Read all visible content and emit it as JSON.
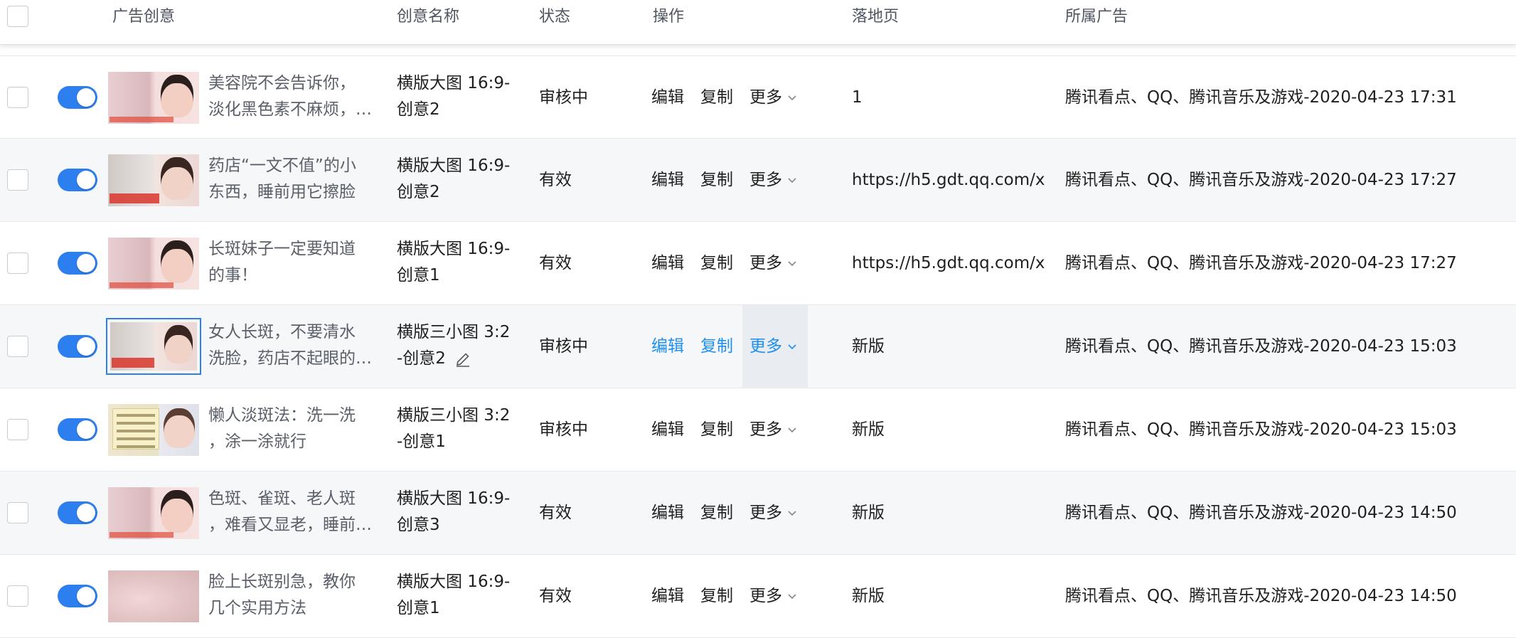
{
  "header": {
    "columns": {
      "creative": "广告创意",
      "name": "创意名称",
      "status": "状态",
      "ops": "操作",
      "landing": "落地页",
      "ad": "所属广告"
    }
  },
  "actions": {
    "edit": "编辑",
    "copy": "复制",
    "more": "更多"
  },
  "colors": {
    "accent": "#2d7ff0",
    "link": "#1c8ff0"
  },
  "rows": [
    {
      "title1": "美容院不会告诉你，",
      "title2": "淡化黑色素不麻烦，…",
      "name1": "横版大图 16:9-",
      "name2": "创意2",
      "status": "审核中",
      "landing": "1",
      "ad": "腾讯看点、QQ、腾讯音乐及游戏-2020-04-23 17:31",
      "enabled": true,
      "icon": "ad-thumbnail-image"
    },
    {
      "title1": "药店“一文不值”的小",
      "title2": "东西，睡前用它擦脸",
      "name1": "横版大图 16:9-",
      "name2": "创意2",
      "status": "有效",
      "landing": "https://h5.gdt.qq.com/x",
      "ad": "腾讯看点、QQ、腾讯音乐及游戏-2020-04-23 17:27",
      "enabled": true,
      "icon": "ad-thumbnail-image"
    },
    {
      "title1": "长斑妹子一定要知道",
      "title2": "的事！",
      "name1": "横版大图 16:9-",
      "name2": "创意1",
      "status": "有效",
      "landing": "https://h5.gdt.qq.com/x",
      "ad": "腾讯看点、QQ、腾讯音乐及游戏-2020-04-23 17:27",
      "enabled": true,
      "icon": "ad-thumbnail-image"
    },
    {
      "title1": "女人长斑，不要清水",
      "title2": "洗脸，药店不起眼的…",
      "name1": "横版三小图 3:2",
      "name2": "-创意2",
      "status": "审核中",
      "landing": "新版",
      "ad": "腾讯看点、QQ、腾讯音乐及游戏-2020-04-23 15:03",
      "enabled": true,
      "hovered": true,
      "icon": "ad-thumbnail-image"
    },
    {
      "title1": "懒人淡斑法：洗一洗",
      "title2": "，涂一涂就行",
      "name1": "横版三小图 3:2",
      "name2": "-创意1",
      "status": "审核中",
      "landing": "新版",
      "ad": "腾讯看点、QQ、腾讯音乐及游戏-2020-04-23 15:03",
      "enabled": true,
      "icon": "ad-thumbnail-image"
    },
    {
      "title1": "色斑、雀斑、老人斑",
      "title2": "，难看又显老，睡前…",
      "name1": "横版大图 16:9-",
      "name2": "创意3",
      "status": "有效",
      "landing": "新版",
      "ad": "腾讯看点、QQ、腾讯音乐及游戏-2020-04-23 14:50",
      "enabled": true,
      "icon": "ad-thumbnail-image"
    },
    {
      "title1": "脸上长斑别急，教你",
      "title2": "几个实用方法",
      "name1": "横版大图 16:9-",
      "name2": "创意1",
      "status": "有效",
      "landing": "新版",
      "ad": "腾讯看点、QQ、腾讯音乐及游戏-2020-04-23 14:50",
      "enabled": true,
      "icon": "ad-thumbnail-image"
    }
  ]
}
